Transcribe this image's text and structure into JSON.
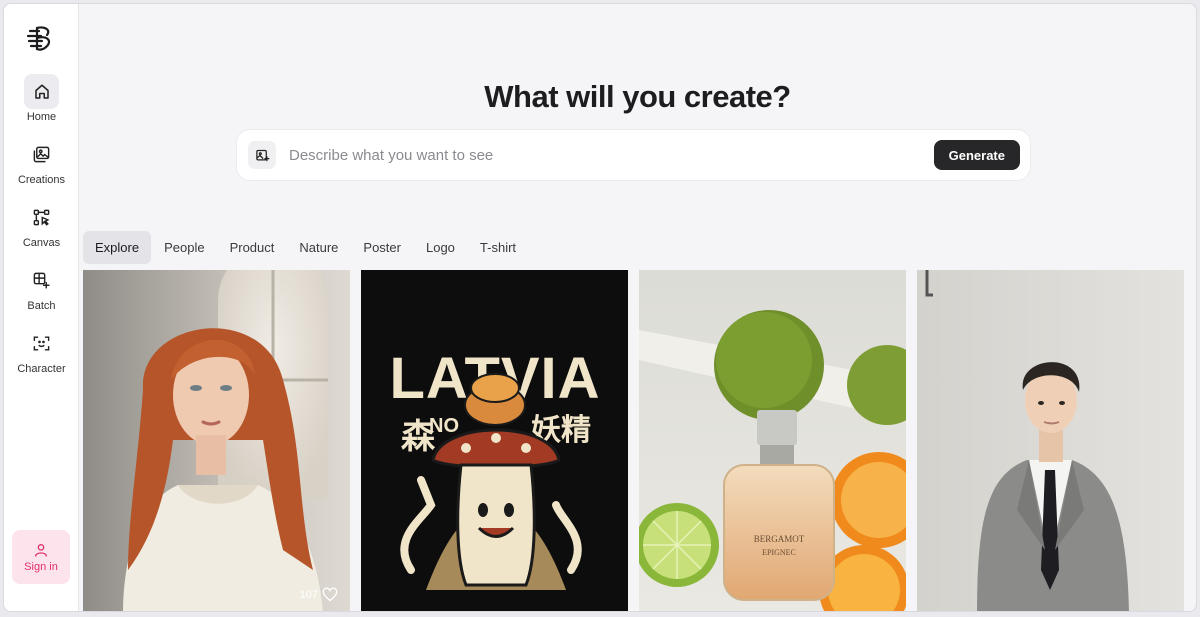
{
  "sidebar": {
    "items": [
      {
        "label": "Home",
        "icon": "home-icon",
        "active": true
      },
      {
        "label": "Creations",
        "icon": "images-icon"
      },
      {
        "label": "Canvas",
        "icon": "canvas-icon"
      },
      {
        "label": "Batch",
        "icon": "batch-icon"
      },
      {
        "label": "Character",
        "icon": "character-icon"
      }
    ],
    "signin_label": "Sign in"
  },
  "main": {
    "headline": "What will you create?",
    "prompt": {
      "placeholder": "Describe what you want to see",
      "value": "",
      "generate_label": "Generate"
    },
    "tabs": [
      "Explore",
      "People",
      "Product",
      "Nature",
      "Poster",
      "Logo",
      "T-shirt"
    ],
    "active_tab": "Explore",
    "gallery": [
      {
        "subject": "portrait of woman with red hair",
        "likes": "107"
      },
      {
        "subject": "LATVIA mushroom t-shirt design",
        "poster_title": "LATVIA",
        "poster_sub": "NO",
        "poster_jp_left": "森",
        "poster_jp_right": "妖精"
      },
      {
        "subject": "perfume bottle with citrus fruits",
        "bottle_text_1": "BERGAMOT",
        "bottle_text_2": "EPIGNEC"
      },
      {
        "subject": "young man in grey suit"
      }
    ]
  },
  "colors": {
    "accent_pink": "#e0306c",
    "signin_bg": "#fde3ec",
    "generate_bg": "#27272a"
  }
}
